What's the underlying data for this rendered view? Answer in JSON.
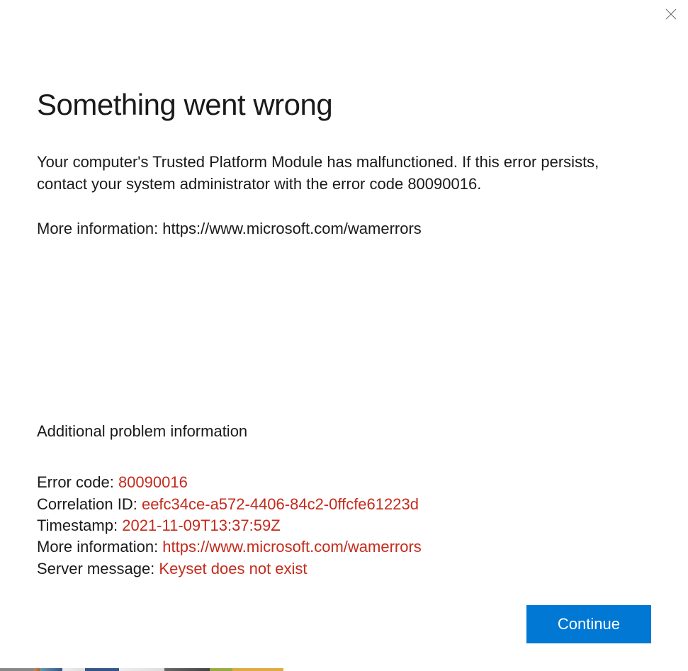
{
  "heading": "Something went wrong",
  "description": "Your computer's Trusted Platform Module has malfunctioned. If this error persists, contact your system administrator with the error code 80090016.",
  "more_info_label": "More information: ",
  "more_info_url": "https://www.microsoft.com/wamerrors",
  "additional_heading": "Additional problem information",
  "details": {
    "error_code": {
      "label": "Error code: ",
      "value": "80090016"
    },
    "correlation_id": {
      "label": "Correlation ID: ",
      "value": "eefc34ce-a572-4406-84c2-0ffcfe61223d"
    },
    "timestamp": {
      "label": "Timestamp: ",
      "value": "2021-11-09T13:37:59Z"
    },
    "more_information": {
      "label": "More information: ",
      "value": "https://www.microsoft.com/wamerrors"
    },
    "server_message": {
      "label": "Server message: ",
      "value": "Keyset does not exist"
    }
  },
  "continue_label": "Continue"
}
